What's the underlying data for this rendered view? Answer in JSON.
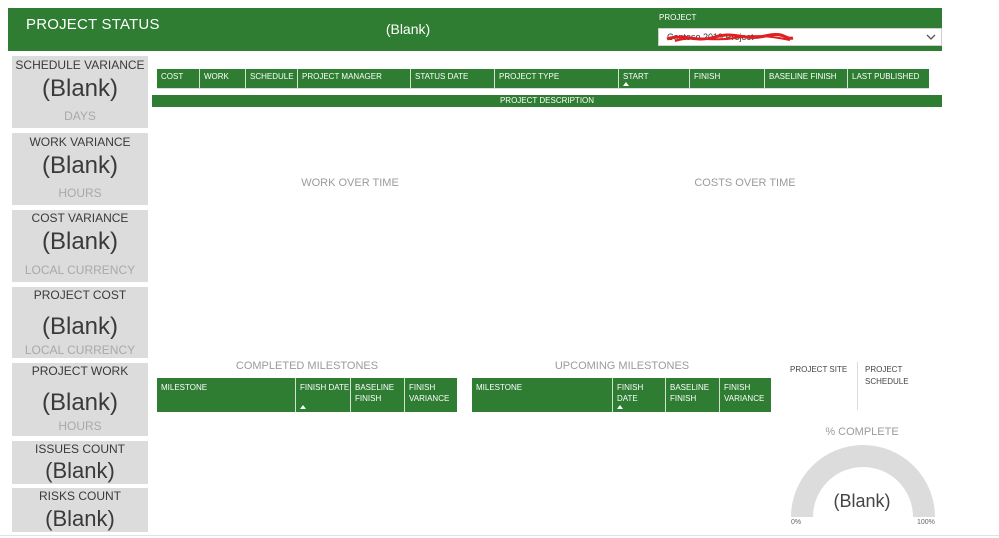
{
  "header": {
    "title": "PROJECT STATUS",
    "blank_value": "(Blank)",
    "project_label": "PROJECT",
    "project_selected": "Contoso 2019 Project"
  },
  "kpis": [
    {
      "title": "SCHEDULE VARIANCE",
      "value": "(Blank)",
      "unit": "DAYS"
    },
    {
      "title": "WORK VARIANCE",
      "value": "(Blank)",
      "unit": "HOURS"
    },
    {
      "title": "COST VARIANCE",
      "value": "(Blank)",
      "unit": "LOCAL CURRENCY"
    },
    {
      "title": "PROJECT COST",
      "value": "(Blank)",
      "unit": "LOCAL CURRENCY"
    },
    {
      "title": "PROJECT WORK",
      "value": "(Blank)",
      "unit": "HOURS"
    },
    {
      "title": "ISSUES COUNT",
      "value": "(Blank)"
    },
    {
      "title": "RISKS COUNT",
      "value": "(Blank)"
    }
  ],
  "info_table": {
    "columns": [
      "COST",
      "WORK",
      "SCHEDULE",
      "PROJECT MANAGER",
      "STATUS DATE",
      "PROJECT TYPE",
      "START",
      "FINISH",
      "BASELINE FINISH",
      "LAST PUBLISHED"
    ]
  },
  "description_label": "PROJECT DESCRIPTION",
  "charts": {
    "work_title": "WORK OVER TIME",
    "costs_title": "COSTS OVER TIME"
  },
  "completed": {
    "title": "COMPLETED MILESTONES",
    "columns": [
      "MILESTONE",
      "FINISH DATE",
      "BASELINE FINISH",
      "FINISH VARIANCE"
    ]
  },
  "upcoming": {
    "title": "UPCOMING MILESTONES",
    "columns": [
      "MILESTONE",
      "FINISH DATE",
      "BASELINE FINISH",
      "FINISH VARIANCE"
    ]
  },
  "links": {
    "site": "PROJECT SITE",
    "schedule": "PROJECT SCHEDULE"
  },
  "gauge": {
    "title": "% COMPLETE",
    "value": "(Blank)",
    "min": "0%",
    "max": "100%"
  },
  "colors": {
    "accent": "#2e7d32",
    "card_bg": "#dcdcdc",
    "scribble": "#e02020"
  },
  "icons": [
    "chevron-down-icon",
    "sort-ascending-icon"
  ]
}
